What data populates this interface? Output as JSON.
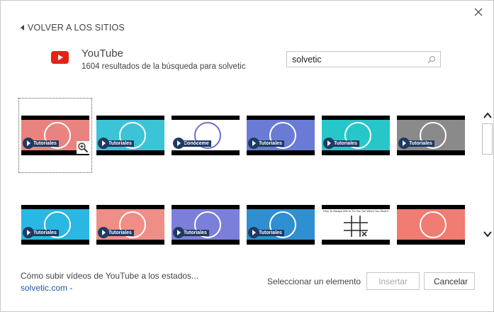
{
  "dialog": {
    "back_label": "VOLVER A LOS SITIOS",
    "provider": {
      "name": "YouTube",
      "results": "1604 resultados de la búsqueda para solvetic",
      "icon": "youtube-icon"
    },
    "search": {
      "value": "solvetic",
      "icon": "search-icon"
    },
    "thumbnails_row1": [
      {
        "badge": "Tutoriales",
        "bg": "#e8837f",
        "accent": "#ffffff"
      },
      {
        "badge": "Tutoriales",
        "bg": "#3cc3d6",
        "accent": "#ffffff"
      },
      {
        "badge": "Conóceme",
        "bg": "#ffffff",
        "accent": "#6b70c7"
      },
      {
        "badge": "Tutoriales",
        "bg": "#6a7bd6",
        "accent": "#ffffff"
      },
      {
        "badge": "Tutoriales",
        "bg": "#27c7c9",
        "accent": "#ffffff"
      },
      {
        "badge": "Tutoriales",
        "bg": "#8a8a8a",
        "accent": "#ffffff"
      }
    ],
    "thumbnails_row2": [
      {
        "badge": "Tutoriales",
        "bg": "#29b7e3",
        "accent": "#ffffff"
      },
      {
        "badge": "Tutoriales",
        "bg": "#ef8e86",
        "accent": "#ffffff"
      },
      {
        "badge": "Tutoriales",
        "bg": "#7c7fd9",
        "accent": "#ffffff"
      },
      {
        "badge": "Tutoriales",
        "bg": "#2f8fd0",
        "accent": "#ffffff"
      },
      {
        "badge": "",
        "bg": "#ffffff",
        "accent": "#222222",
        "text": "How To Always Win In Tic Tac Toe When You Start As X"
      },
      {
        "badge": "",
        "bg": "#f07c72",
        "accent": "#ffffff"
      }
    ],
    "footer": {
      "caption": "Cómo subir vídeos de YouTube a los estados...",
      "source": "solvetic.com -",
      "status": "Seleccionar un elemento",
      "insert_label": "Insertar",
      "cancel_label": "Cancelar"
    }
  }
}
